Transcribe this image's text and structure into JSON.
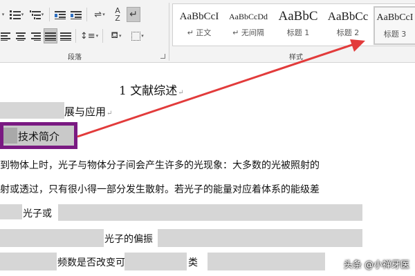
{
  "ribbon": {
    "paragraph_group_label": "段落",
    "styles_group_label": "样式",
    "styles": [
      {
        "sample": "AaBbCcI",
        "name": "正文"
      },
      {
        "sample": "AaBbCcDd",
        "name": "无间隔"
      },
      {
        "sample": "AaBbC",
        "name": "标题 1"
      },
      {
        "sample": "AaBbCc",
        "name": "标题 2"
      },
      {
        "sample": "AaBbCcI",
        "name": "标题 3"
      }
    ],
    "accent_arrow_color": "#e23b3b",
    "highlight_box_color": "#7a1a82"
  },
  "document": {
    "chapter_title": "1 文献综述",
    "section_heading_tail": "展与应用",
    "highlighted_heading": "技术简介",
    "paragraph_lines": [
      "到物体上时，光子与物体分子间会产生许多的光现象：大多数的光被照射的",
      "射或透过，只有很小得一部分发生散射。若光子的能量对应着体系的能级差",
      "光子或",
      "光子的偏振",
      "频数是否改变可",
      "类"
    ]
  },
  "watermark": "头条 @小禅牙医"
}
